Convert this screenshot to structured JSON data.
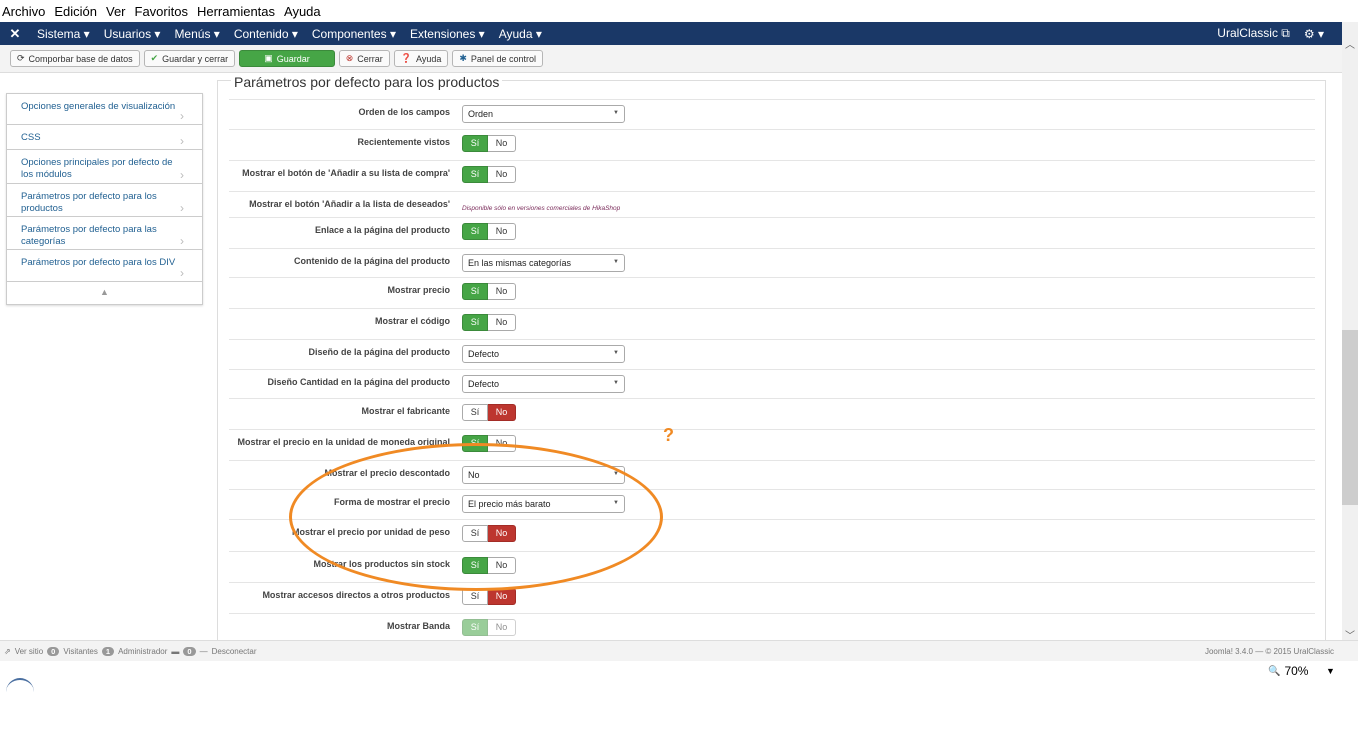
{
  "menubar": [
    "Archivo",
    "Edición",
    "Ver",
    "Favoritos",
    "Herramientas",
    "Ayuda"
  ],
  "topnav": {
    "logo": "✕",
    "items": [
      "Sistema ▾",
      "Usuarios ▾",
      "Menús ▾",
      "Contenido ▾",
      "Componentes ▾",
      "Extensiones ▾",
      "Ayuda ▾"
    ],
    "site_name": "UralClassic ⧉",
    "settings": "⚙ ▾"
  },
  "toolbar": {
    "check_db": "Comporbar base de datos",
    "save_close": "Guardar y cerrar",
    "save": "Guardar",
    "close": "Cerrar",
    "help": "Ayuda",
    "control_panel": "Panel de control"
  },
  "sidebar": {
    "items": [
      "Opciones generales de visualización",
      "CSS",
      "Opciones principales por defecto de los módulos",
      "Parámetros por defecto para los productos",
      "Parámetros por defecto para las categorías",
      "Parámetros por defecto para los DIV"
    ],
    "footer": "▲"
  },
  "panel": {
    "legend": "Parámetros por defecto para los productos"
  },
  "rows": [
    {
      "label": "Orden de los campos",
      "type": "select",
      "value": "Orden"
    },
    {
      "label": "Recientemente vistos",
      "type": "toggle",
      "yes": "Sí",
      "no": "No",
      "on": "yes"
    },
    {
      "label": "Mostrar el botón de 'Añadir a su lista de compra'",
      "type": "toggle",
      "yes": "Sí",
      "no": "No",
      "on": "yes"
    },
    {
      "label": "Mostrar el botón 'Añadir a la lista de deseados'",
      "type": "note",
      "value": "Disponible sólo en versiones comerciales de HikaShop"
    },
    {
      "label": "Enlace a la página del producto",
      "type": "toggle",
      "yes": "Sí",
      "no": "No",
      "on": "yes"
    },
    {
      "label": "Contenido de la página del producto",
      "type": "select",
      "value": "En las mismas categorías"
    },
    {
      "label": "Mostrar precio",
      "type": "toggle",
      "yes": "Sí",
      "no": "No",
      "on": "yes"
    },
    {
      "label": "Mostrar el código",
      "type": "toggle",
      "yes": "Sí",
      "no": "No",
      "on": "yes"
    },
    {
      "label": "Diseño de la página del producto",
      "type": "select",
      "value": "Defecto"
    },
    {
      "label": "Diseño Cantidad en la página del producto",
      "type": "select",
      "value": "Defecto"
    },
    {
      "label": "Mostrar el fabricante",
      "type": "toggle",
      "yes": "Sí",
      "no": "No",
      "on": "no"
    },
    {
      "label": "Mostrar el precio en la unidad de moneda original",
      "type": "toggle",
      "yes": "Sí",
      "no": "No",
      "on": "yes"
    },
    {
      "label": "Mostrar el precio descontado",
      "type": "select",
      "value": "No"
    },
    {
      "label": "Forma de mostrar el precio",
      "type": "select",
      "value": "El precio más barato"
    },
    {
      "label": "Mostrar el precio por unidad de peso",
      "type": "toggle",
      "yes": "Sí",
      "no": "No",
      "on": "no"
    },
    {
      "label": "Mostrar los productos sin stock",
      "type": "toggle",
      "yes": "Sí",
      "no": "No",
      "on": "yes"
    },
    {
      "label": "Mostrar accesos directos a otros productos",
      "type": "toggle",
      "yes": "Sí",
      "no": "No",
      "on": "no"
    },
    {
      "label": "Mostrar Banda",
      "type": "toggle",
      "yes": "Sí",
      "no": "No",
      "on": "yes",
      "faded": true
    }
  ],
  "annotation": {
    "question": "?"
  },
  "status": {
    "view_site": "Ver sitio",
    "visitors_count": "0",
    "visitors": "Visitantes",
    "admin_count": "1",
    "admin": "Administrador",
    "messages_count": "0",
    "sep": "—",
    "logout": "Desconectar",
    "version": "Joomla! 3.4.0 — © 2015 UralClassic"
  },
  "zoom": {
    "icon": "🔍",
    "level": "70%",
    "dropdown": "▼"
  },
  "colors": {
    "nav": "#1a3867",
    "green": "#46a546",
    "red": "#bd362f",
    "annotation": "#f08a24"
  }
}
